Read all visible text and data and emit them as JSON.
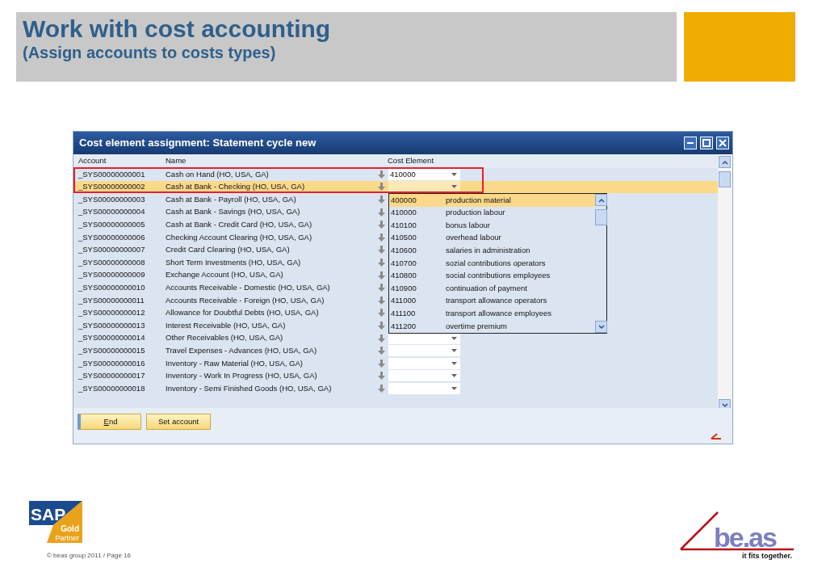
{
  "slide": {
    "title": "Work with cost accounting",
    "subtitle": "(Assign accounts to costs types)",
    "footer": "© beas group 2011 / Page 16"
  },
  "sap_logo": {
    "brand": "SAP",
    "tier": "Gold",
    "label": "Partner"
  },
  "beas_logo": {
    "brand": "be.as",
    "tagline": "it fits together."
  },
  "window": {
    "title": "Cost element assignment: Statement cycle new"
  },
  "table": {
    "columns": [
      "Account",
      "Name",
      "Cost Element"
    ],
    "rows": [
      {
        "account": "_SYS00000000001",
        "name": "Cash on Hand (HO, USA, GA)",
        "cost_element": "410000",
        "selected": false
      },
      {
        "account": "_SYS00000000002",
        "name": "Cash at Bank - Checking (HO, USA, GA)",
        "selected": true
      },
      {
        "account": "_SYS00000000003",
        "name": "Cash at Bank - Payroll (HO, USA, GA)",
        "selected": false
      },
      {
        "account": "_SYS00000000004",
        "name": "Cash at Bank - Savings (HO, USA, GA)",
        "selected": false
      },
      {
        "account": "_SYS00000000005",
        "name": "Cash at Bank - Credit Card (HO, USA, GA)",
        "selected": false
      },
      {
        "account": "_SYS00000000006",
        "name": "Checking Account Clearing (HO, USA, GA)",
        "selected": false
      },
      {
        "account": "_SYS00000000007",
        "name": "Credit Card Clearing (HO, USA, GA)",
        "selected": false
      },
      {
        "account": "_SYS00000000008",
        "name": "Short Term Investments (HO, USA, GA)",
        "selected": false
      },
      {
        "account": "_SYS00000000009",
        "name": "Exchange Account (HO, USA, GA)",
        "selected": false
      },
      {
        "account": "_SYS00000000010",
        "name": "Accounts Receivable - Domestic (HO, USA, GA)",
        "selected": false
      },
      {
        "account": "_SYS00000000011",
        "name": "Accounts Receivable - Foreign (HO, USA, GA)",
        "selected": false
      },
      {
        "account": "_SYS00000000012",
        "name": "Allowance for Doubtful Debts (HO, USA, GA)",
        "selected": false
      },
      {
        "account": "_SYS00000000013",
        "name": "Interest Receivable (HO, USA, GA)",
        "selected": false
      },
      {
        "account": "_SYS00000000014",
        "name": "Other Receivables (HO, USA, GA)",
        "selected": false
      },
      {
        "account": "_SYS00000000015",
        "name": "Travel Expenses - Advances (HO, USA, GA)",
        "selected": false
      },
      {
        "account": "_SYS00000000016",
        "name": "Inventory - Raw Material (HO, USA, GA)",
        "selected": false
      },
      {
        "account": "_SYS00000000017",
        "name": "Inventory - Work In Progress (HO, USA, GA)",
        "selected": false
      },
      {
        "account": "_SYS00000000018",
        "name": "Inventory - Semi Finished Goods (HO, USA, GA)",
        "selected": false
      }
    ]
  },
  "dropdown": {
    "items": [
      {
        "code": "400000",
        "description": "production material",
        "selected": true
      },
      {
        "code": "410000",
        "description": "production labour",
        "selected": false
      },
      {
        "code": "410100",
        "description": "bonus labour",
        "selected": false
      },
      {
        "code": "410500",
        "description": "overhead labour",
        "selected": false
      },
      {
        "code": "410600",
        "description": "salaries in administration",
        "selected": false
      },
      {
        "code": "410700",
        "description": "sozial contributions operators",
        "selected": false
      },
      {
        "code": "410800",
        "description": "social contributions employees",
        "selected": false
      },
      {
        "code": "410900",
        "description": "continuation of payment",
        "selected": false
      },
      {
        "code": "411000",
        "description": "transport allowance operators",
        "selected": false
      },
      {
        "code": "411100",
        "description": "transport allowance employees",
        "selected": false
      },
      {
        "code": "411200",
        "description": "overtime premium",
        "selected": false
      }
    ]
  },
  "buttons": [
    {
      "label": "End",
      "underline_first": true
    },
    {
      "label": "Set account",
      "underline_first": false
    }
  ]
}
